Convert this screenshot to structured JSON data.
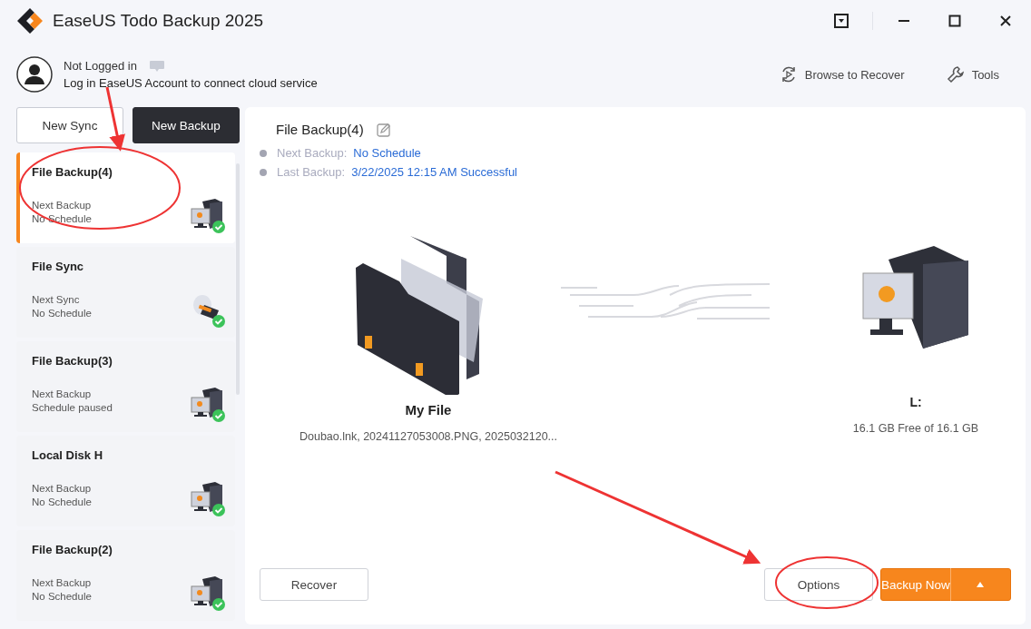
{
  "window": {
    "title": "EaseUS Todo Backup 2025"
  },
  "account": {
    "status": "Not Logged in",
    "hint": "Log in EaseUS Account to connect cloud service"
  },
  "toolbar": [
    {
      "label": "Browse to Recover",
      "kind": "recover"
    },
    {
      "label": "Tools",
      "kind": "tools"
    }
  ],
  "sidebar": {
    "buttons": [
      {
        "label": "New Sync",
        "kind": "outline"
      },
      {
        "label": "New Backup",
        "kind": "dark"
      }
    ],
    "items": [
      {
        "title": "File Backup(4)",
        "line_1": "Next Backup",
        "line_2": "No Schedule",
        "kind": "backup",
        "selected": true
      },
      {
        "title": "File Sync",
        "line_1": "Next Sync",
        "line_2": "No Schedule",
        "kind": "sync",
        "selected": false
      },
      {
        "title": "File Backup(3)",
        "line_1": "Next Backup",
        "line_2": "Schedule paused",
        "kind": "backup",
        "selected": false
      },
      {
        "title": "Local Disk H",
        "line_1": "Next Backup",
        "line_2": "No Schedule",
        "kind": "backup",
        "selected": false
      },
      {
        "title": "File Backup(2)",
        "line_1": "Next Backup",
        "line_2": "No Schedule",
        "kind": "backup",
        "selected": false
      }
    ]
  },
  "detail": {
    "title": "File Backup(4)",
    "info": [
      {
        "label": "Next Backup:",
        "value": "No Schedule"
      },
      {
        "label": "Last Backup:",
        "value": "3/22/2025 12:15 AM Successful"
      }
    ],
    "source": {
      "name": "My File",
      "files": "Doubao.lnk, 20241127053008.PNG, 2025032120..."
    },
    "target": {
      "name": "L:",
      "space": "16.1 GB Free of 16.1 GB"
    },
    "buttons": [
      {
        "label": "Recover",
        "kind": "plain"
      },
      {
        "label": "Options",
        "kind": "plain"
      },
      {
        "label": "Backup Now",
        "kind": "primary"
      }
    ]
  }
}
